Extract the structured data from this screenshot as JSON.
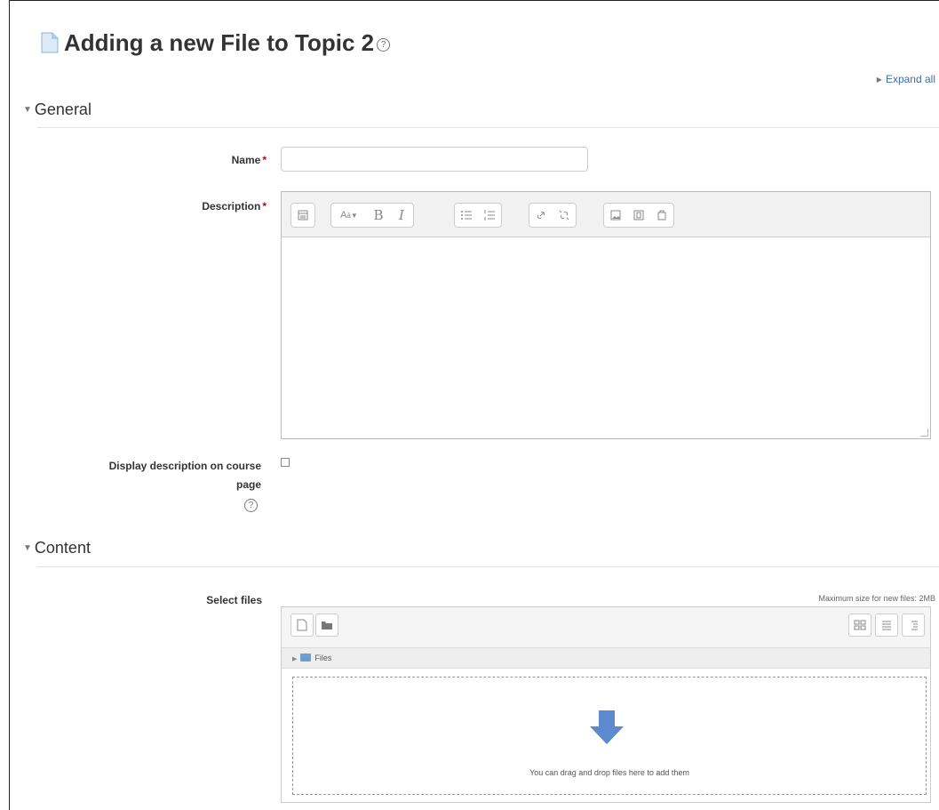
{
  "page": {
    "title": "Adding a new File to Topic 2",
    "expand_all": "Expand all"
  },
  "sections": {
    "general": "General",
    "content": "Content"
  },
  "fields": {
    "name_label": "Name",
    "name_value": "",
    "description_label": "Description",
    "display_description_label_line1": "Display description on course",
    "display_description_label_line2": "page",
    "display_description_checked": false,
    "required_marker": "*",
    "select_files_label": "Select files"
  },
  "editor": {
    "toolbar_icons": [
      "collapse-icon",
      "style-icon",
      "bold-icon",
      "italic-icon",
      "unordered-list-icon",
      "ordered-list-icon",
      "link-icon",
      "unlink-icon",
      "image-icon",
      "media-icon",
      "manage-files-icon"
    ],
    "bold": "B",
    "italic": "I",
    "style_glyph": "A"
  },
  "filepicker": {
    "max_size": "Maximum size for new files: 2MB",
    "path_folder": "Files",
    "drop_text": "You can drag and drop files here to add them",
    "accent": "#5b8ad1"
  }
}
